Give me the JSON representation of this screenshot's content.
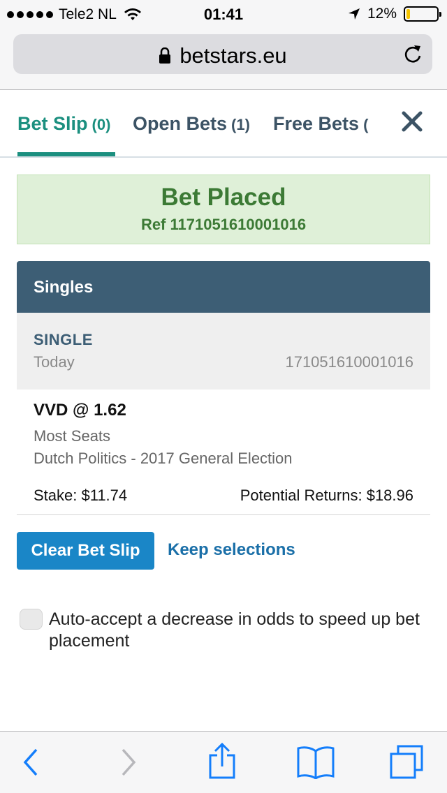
{
  "status_bar": {
    "carrier": "Tele2 NL",
    "time": "01:41",
    "battery": "12%",
    "battery_level": 0.12,
    "battery_color": "#f5c400"
  },
  "browser": {
    "url": "betstars.eu",
    "icons": {
      "lock": "lock-icon",
      "reload": "reload-icon"
    }
  },
  "tabs": [
    {
      "label": "Bet Slip",
      "count": "(0)",
      "active": true
    },
    {
      "label": "Open Bets",
      "count": "(1)",
      "active": false
    },
    {
      "label": "Free Bets",
      "count": "(",
      "active": false
    }
  ],
  "close_icon": "close-icon",
  "banner": {
    "title": "Bet Placed",
    "ref": "Ref 1171051610001016",
    "color": "#3c7a35",
    "background": "#dff0d8"
  },
  "singles": {
    "header": "Singles",
    "type": "SINGLE",
    "date": "Today",
    "ref": "171051610001016",
    "selection": "VVD @ 1.62",
    "market": "Most Seats",
    "event": "Dutch Politics - 2017 General Election",
    "stake": "Stake: $11.74",
    "returns": "Potential Returns: $18.96"
  },
  "actions": {
    "clear": "Clear Bet Slip",
    "keep": "Keep selections"
  },
  "auto_accept": {
    "label": "Auto-accept a decrease in odds to speed up bet placement",
    "checked": false
  },
  "toolbar": {
    "icons": [
      "back-icon",
      "forward-icon",
      "share-icon",
      "bookmarks-icon",
      "tabs-icon"
    ]
  },
  "colors": {
    "accent_teal": "#1b8f7f",
    "header_blue": "#3d5e75",
    "button_blue": "#1a86c7",
    "ios_blue": "#147efb"
  }
}
